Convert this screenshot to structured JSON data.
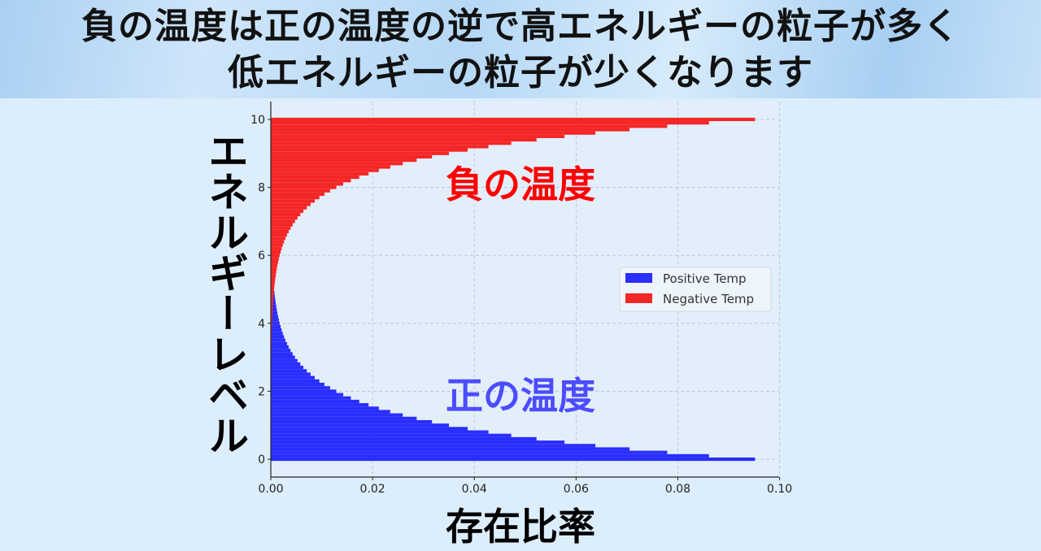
{
  "title_lines": [
    "負の温度は正の温度の逆で高エネルギーの粒子が多く",
    "低エネルギーの粒子が少くなります"
  ],
  "chart_data": {
    "type": "bar",
    "orientation": "horizontal",
    "xlabel": "存在比率",
    "ylabel": "エネルギーレベル",
    "xlim": [
      0,
      0.0999
    ],
    "ylim": [
      -0.525,
      10.525
    ],
    "xticks": [
      "0.00",
      "0.02",
      "0.04",
      "0.06",
      "0.08",
      "0.10"
    ],
    "yticks": [
      "0",
      "2",
      "4",
      "6",
      "8",
      "10"
    ],
    "grid": true,
    "legend_position": "center-right",
    "energy_levels": {
      "start": 0,
      "stop": 10,
      "step": 0.1
    },
    "series": [
      {
        "name": "Positive Temp",
        "color": "#2a2eff",
        "values": [
          0.09516,
          0.08611,
          0.07791,
          0.0705,
          0.06379,
          0.05772,
          0.05222,
          0.04725,
          0.04276,
          0.03869,
          0.03501,
          0.03168,
          0.02866,
          0.02593,
          0.02347,
          0.02123,
          0.01921,
          0.01738,
          0.01573,
          0.01423,
          0.01288,
          0.01165,
          0.01054,
          0.00954,
          0.00863,
          0.00781,
          0.00707,
          0.0064,
          0.00579,
          0.00524,
          0.00474,
          0.00429,
          0.00388,
          0.00351,
          0.00318,
          0.00287,
          0.0026,
          0.00235,
          0.00213,
          0.00193,
          0.00174,
          0.00158,
          0.00143,
          0.00129,
          0.00117,
          0.00106,
          0.00096,
          0.00087,
          0.00078,
          0.00071,
          0.00064,
          0.00058,
          0.00052,
          0.00048,
          0.00043,
          0.00039,
          0.00035,
          0.00032,
          0.00029,
          0.00026,
          0.00024,
          0.00021,
          0.00019,
          0.00017,
          0.00016,
          0.00014,
          0.00013,
          0.00012,
          0.00011,
          0.0001,
          9e-05,
          8e-05,
          7e-05,
          6e-05,
          6e-05,
          5e-05,
          5e-05,
          4e-05,
          4e-05,
          4e-05,
          3e-05,
          3e-05,
          3e-05,
          2e-05,
          2e-05,
          2e-05,
          2e-05,
          2e-05,
          1e-05,
          1e-05,
          1e-05,
          1e-05,
          1e-05,
          1e-05,
          1e-05,
          1e-05,
          1e-05,
          1e-05,
          1e-05,
          0,
          0
        ]
      },
      {
        "name": "Negative Temp",
        "color": "#f52626",
        "values": [
          0,
          0,
          1e-05,
          1e-05,
          1e-05,
          1e-05,
          1e-05,
          1e-05,
          1e-05,
          1e-05,
          1e-05,
          1e-05,
          1e-05,
          2e-05,
          2e-05,
          2e-05,
          2e-05,
          2e-05,
          3e-05,
          3e-05,
          3e-05,
          4e-05,
          4e-05,
          4e-05,
          5e-05,
          5e-05,
          6e-05,
          6e-05,
          7e-05,
          8e-05,
          9e-05,
          0.0001,
          0.00011,
          0.00012,
          0.00013,
          0.00014,
          0.00016,
          0.00017,
          0.00019,
          0.00021,
          0.00024,
          0.00026,
          0.00029,
          0.00032,
          0.00035,
          0.00039,
          0.00043,
          0.00048,
          0.00052,
          0.00058,
          0.00064,
          0.00071,
          0.00078,
          0.00087,
          0.00096,
          0.00106,
          0.00117,
          0.00129,
          0.00143,
          0.00158,
          0.00174,
          0.00193,
          0.00213,
          0.00235,
          0.0026,
          0.00287,
          0.00318,
          0.00351,
          0.00388,
          0.00429,
          0.00474,
          0.00524,
          0.00579,
          0.0064,
          0.00707,
          0.00781,
          0.00863,
          0.00954,
          0.01054,
          0.01165,
          0.01288,
          0.01423,
          0.01573,
          0.01738,
          0.01921,
          0.02123,
          0.02347,
          0.02593,
          0.02866,
          0.03168,
          0.03501,
          0.03869,
          0.04276,
          0.04725,
          0.05222,
          0.05772,
          0.06379,
          0.0705,
          0.07791,
          0.08611,
          0.09516
        ]
      }
    ],
    "annotations": [
      {
        "text": "負の温度",
        "color": "#ff0000"
      },
      {
        "text": "正の温度",
        "color": "#4c4cff"
      }
    ]
  }
}
